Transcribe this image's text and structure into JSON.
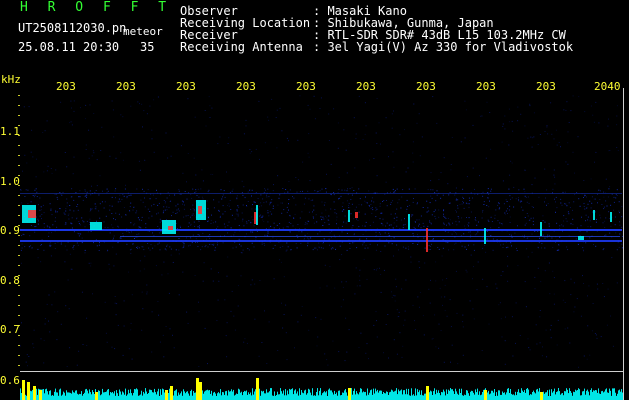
{
  "header": {
    "app_name": "H R O F F T",
    "filename": "UT2508112030.pn",
    "mode": "meteor",
    "datetime": "25.08.11 20:30",
    "channel": "35"
  },
  "info": {
    "observer_label": "Observer",
    "observer_value": ": Masaki Kano",
    "location_label": "Receiving Location",
    "location_value": ": Shibukawa, Gunma, Japan",
    "receiver_label": "Receiver",
    "receiver_value": ": RTL-SDR SDR# 43dB L15 103.2MHz CW",
    "antenna_label": "Receiving Antenna",
    "antenna_value": ": 3el Yagi(V) Az 330 for Vladivostok"
  },
  "axes": {
    "unit": "kHz",
    "freq_ticks": [
      "1.1",
      "1.0",
      "0.9",
      "0.8",
      "0.7",
      "0.6"
    ],
    "time_ticks": [
      "203",
      "203",
      "203",
      "203",
      "203",
      "203",
      "203",
      "203",
      "203",
      "2040"
    ]
  },
  "colors": {
    "background": "#000000",
    "label_yellow": "#ffff33",
    "title_green": "#33ff33",
    "carrier_blue": "#1d3cff",
    "signal_cyan": "#00ffff",
    "signal_red": "#ff3030",
    "meter_yellow": "#ffff00"
  }
}
